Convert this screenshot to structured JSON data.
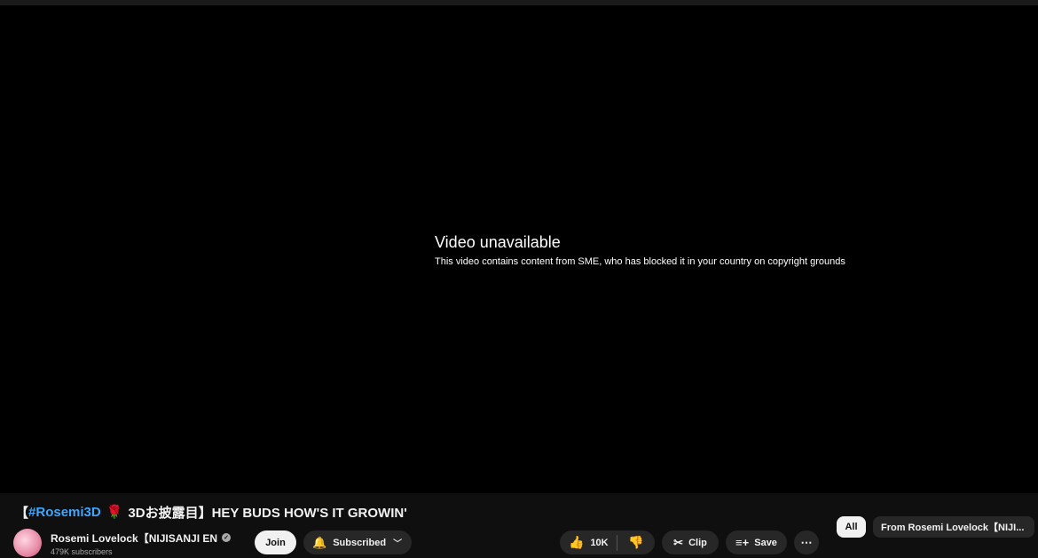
{
  "player": {
    "error_title": "Video unavailable",
    "error_message": "This video contains content from SME, who has blocked it in your country on copyright grounds"
  },
  "video": {
    "title_open": "【",
    "title_hashtag": "#Rosemi3D",
    "title_emoji": "🌹",
    "title_rest": "3Dお披露目】HEY BUDS HOW'S IT GROWIN'"
  },
  "channel": {
    "name": "Rosemi Lovelock【NIJISANJI EN",
    "subscribers": "479K subscribers"
  },
  "actions": {
    "join_label": "Join",
    "subscribed_label": "Subscribed",
    "like_count": "10K",
    "clip_label": "Clip",
    "save_label": "Save",
    "more_label": "⋯"
  },
  "chips": {
    "all_label": "All",
    "from_label": "From Rosemi Lovelock【NIJI..."
  },
  "icons": {
    "bell": "🔔",
    "chevron": "﹀",
    "like": "👍",
    "dislike": "👎",
    "clip": "✂",
    "save": "≡+",
    "verified": "✓"
  },
  "colors": {
    "hashtag": "#3ea6ff",
    "background": "#0f0f0f",
    "button_bg": "#272727"
  }
}
